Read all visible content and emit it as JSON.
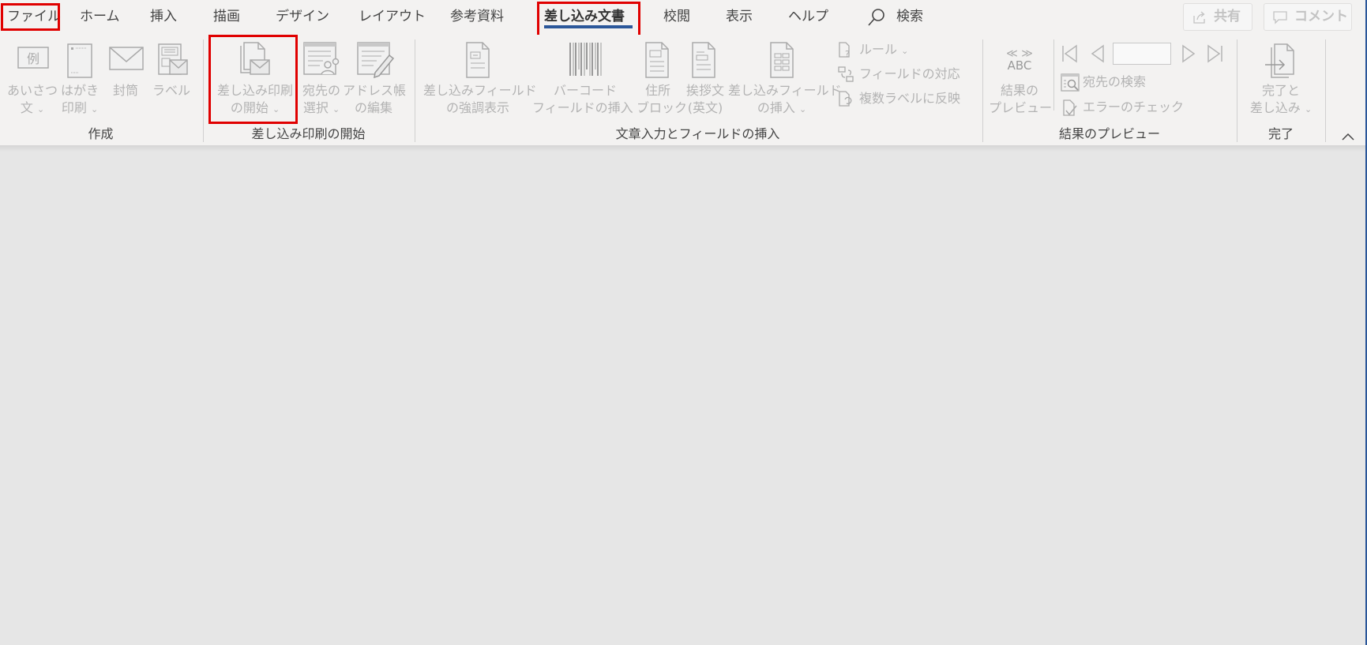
{
  "tabs": [
    {
      "label": "ファイル",
      "highlighted": true
    },
    {
      "label": "ホーム"
    },
    {
      "label": "挿入"
    },
    {
      "label": "描画"
    },
    {
      "label": "デザイン"
    },
    {
      "label": "レイアウト"
    },
    {
      "label": "参考資料"
    },
    {
      "label": "差し込み文書",
      "active": true,
      "highlighted": true
    },
    {
      "label": "校閲"
    },
    {
      "label": "表示"
    },
    {
      "label": "ヘルプ"
    }
  ],
  "search": {
    "label": "検索",
    "icon": "search-icon"
  },
  "top_buttons": {
    "share": {
      "label": "共有",
      "icon": "share-icon"
    },
    "comment": {
      "label": "コメント",
      "icon": "comment-icon"
    }
  },
  "ribbon": {
    "groups": {
      "create": {
        "label": "作成",
        "buttons": [
          {
            "line1": "あいさつ",
            "line2": "文",
            "dropdown": true,
            "icon": "greeting-example-icon",
            "icon_text": "例"
          },
          {
            "line1": "はがき",
            "line2": "印刷",
            "dropdown": true,
            "icon": "postcard-icon"
          },
          {
            "line1": "封筒",
            "line2": "",
            "icon": "envelope-icon"
          },
          {
            "line1": "ラベル",
            "line2": "",
            "icon": "label-icon"
          }
        ]
      },
      "start_merge": {
        "label": "差し込み印刷の開始",
        "buttons": [
          {
            "line1": "差し込み印刷",
            "line2": "の開始",
            "dropdown": true,
            "icon": "start-mail-merge-icon",
            "highlighted": true
          },
          {
            "line1": "宛先の",
            "line2": "選択",
            "dropdown": true,
            "icon": "select-recipients-icon"
          },
          {
            "line1": "アドレス帳",
            "line2": "の編集",
            "icon": "edit-recipient-list-icon"
          }
        ]
      },
      "write_insert": {
        "label": "文章入力とフィールドの挿入",
        "buttons": [
          {
            "line1": "差し込みフィールド",
            "line2": "の強調表示",
            "icon": "highlight-fields-icon"
          },
          {
            "line1": "バーコード",
            "line2": "フィールドの挿入",
            "dropdown": true,
            "icon": "barcode-icon"
          },
          {
            "line1": "住所",
            "line2": "ブロック",
            "icon": "address-block-icon"
          },
          {
            "line1": "挨拶文",
            "line2": "(英文)",
            "icon": "greeting-line-icon"
          },
          {
            "line1": "差し込みフィールド",
            "line2": "の挿入",
            "dropdown": true,
            "icon": "insert-merge-field-icon"
          }
        ],
        "small_buttons": [
          {
            "label": "ルール",
            "dropdown": true,
            "icon": "rules-icon"
          },
          {
            "label": "フィールドの対応",
            "icon": "match-fields-icon"
          },
          {
            "label": "複数ラベルに反映",
            "icon": "update-labels-icon"
          }
        ]
      },
      "preview": {
        "label": "結果のプレビュー",
        "buttons": [
          {
            "line1": "結果の",
            "line2": "プレビュー",
            "icon": "preview-results-icon",
            "icon_text": "ABC"
          }
        ],
        "nav": {
          "first": "first-record-icon",
          "previous": "previous-record-icon",
          "record_value": "",
          "next": "next-record-icon",
          "last": "last-record-icon"
        },
        "small_buttons": [
          {
            "label": "宛先の検索",
            "icon": "find-recipient-icon"
          },
          {
            "label": "エラーのチェック",
            "icon": "check-errors-icon"
          }
        ]
      },
      "finish": {
        "label": "完了",
        "buttons": [
          {
            "line1": "完了と",
            "line2": "差し込み",
            "dropdown": true,
            "icon": "finish-merge-icon"
          }
        ]
      }
    },
    "collapse_icon": "collapse-ribbon-icon"
  },
  "colors": {
    "accent": "#2b579a",
    "highlight_box": "#e00000",
    "ribbon_bg": "#f3f2f1",
    "canvas_bg": "#e6e6e6",
    "disabled_text": "#b3b3b3"
  }
}
